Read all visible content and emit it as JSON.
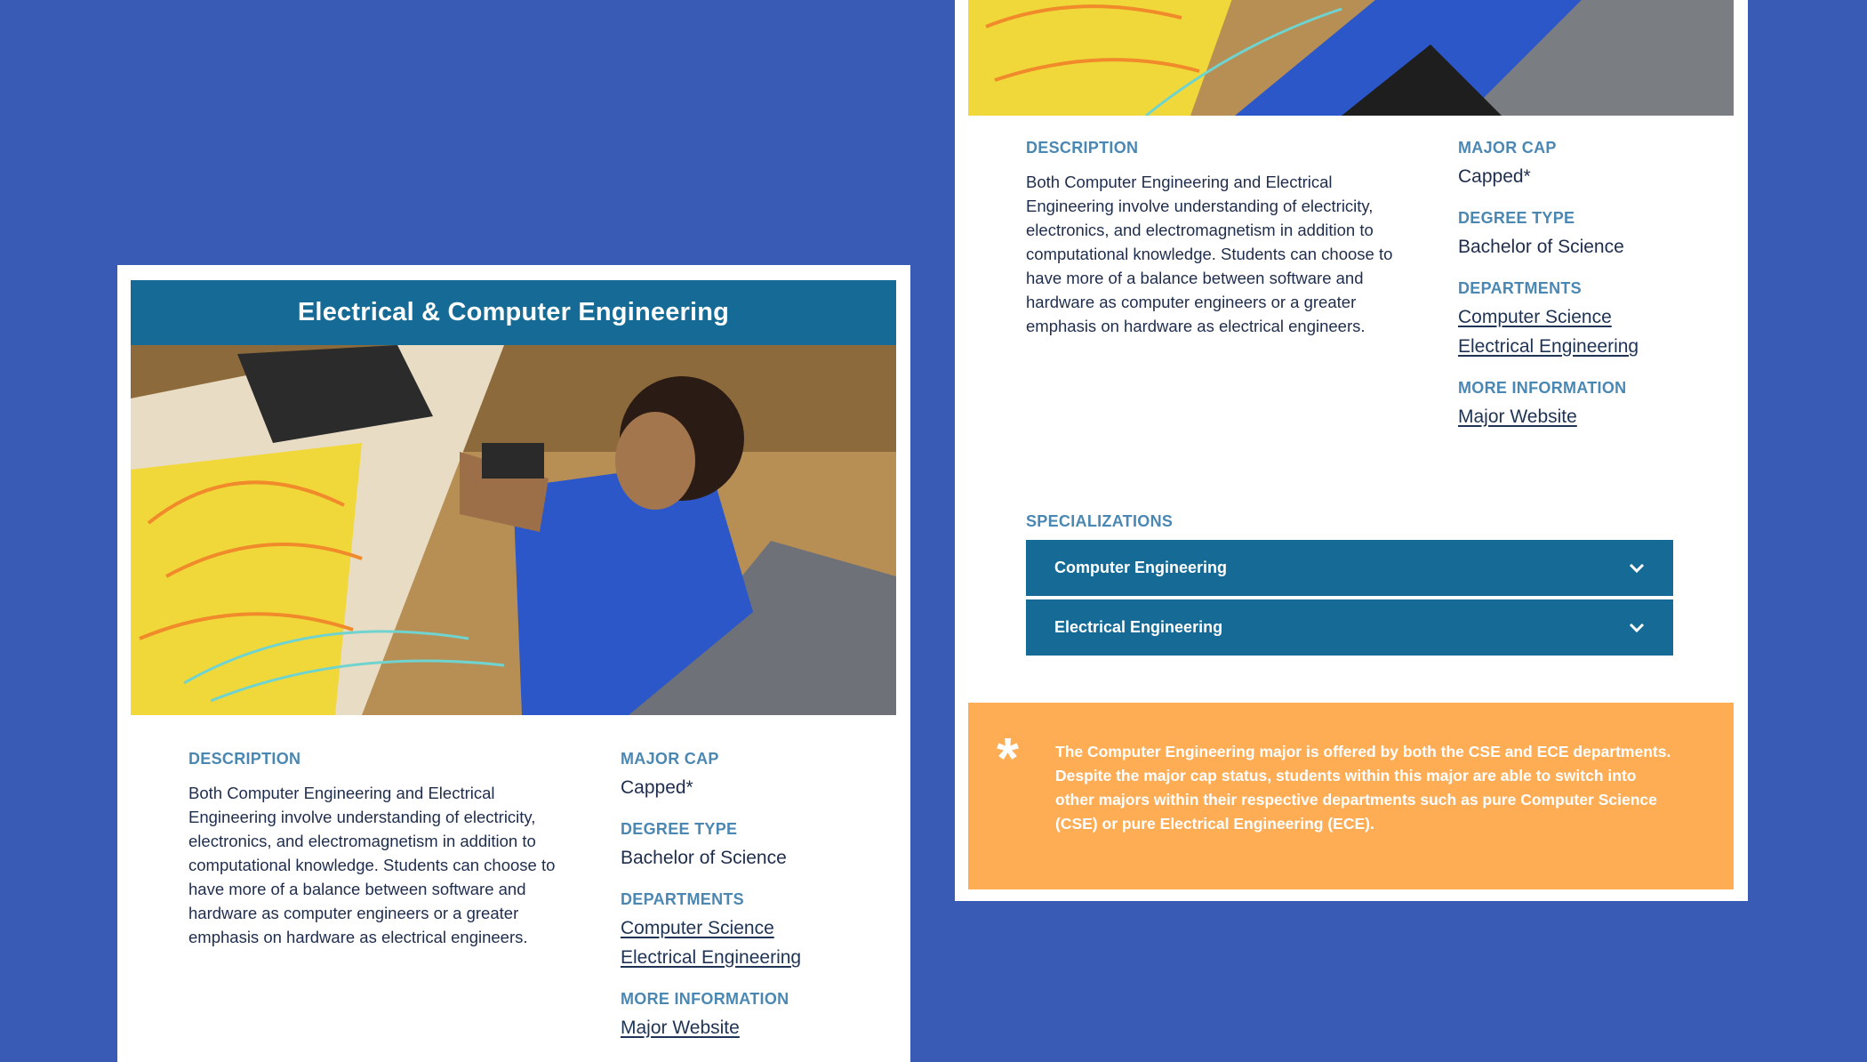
{
  "colors": {
    "background": "#3a5bb5",
    "title_bar": "#156b96",
    "label": "#4a88b3",
    "note_bg": "#ffad55"
  },
  "left_card": {
    "title": "Electrical & Computer Engineering",
    "description_label": "DESCRIPTION",
    "description": "Both Computer Engineering and Electrical Engineering involve understanding of electricity, electronics, and electromagnetism in addition to computational knowledge. Students can choose to have more of a balance between software and hardware as computer engineers or a greater emphasis on hardware as electrical engineers.",
    "major_cap_label": "MAJOR CAP",
    "major_cap": "Capped*",
    "degree_type_label": "DEGREE TYPE",
    "degree_type": "Bachelor of Science",
    "departments_label": "DEPARTMENTS",
    "departments": [
      "Computer Science",
      "Electrical Engineering"
    ],
    "more_info_label": "MORE INFORMATION",
    "more_info_link": "Major Website"
  },
  "right_card": {
    "description_label": "DESCRIPTION",
    "description": "Both Computer Engineering and Electrical Engineering involve understanding of electricity, electronics, and electromagnetism in addition to computational knowledge. Students can choose to have more of a balance between software and hardware as computer engineers or a greater emphasis on hardware as electrical engineers.",
    "major_cap_label": "MAJOR CAP",
    "major_cap": "Capped*",
    "degree_type_label": "DEGREE TYPE",
    "degree_type": "Bachelor of Science",
    "departments_label": "DEPARTMENTS",
    "departments": [
      "Computer Science",
      "Electrical Engineering"
    ],
    "more_info_label": "MORE INFORMATION",
    "more_info_link": "Major Website",
    "specializations_label": "SPECIALIZATIONS",
    "specializations": [
      "Computer Engineering",
      "Electrical Engineering"
    ],
    "note_symbol": "*",
    "note_text": "The Computer Engineering major is offered by both the CSE and ECE departments. Despite the major cap status, students within this major are able to switch into other majors within their respective departments such as pure Computer Science (CSE) or pure Electrical Engineering (ECE)."
  }
}
